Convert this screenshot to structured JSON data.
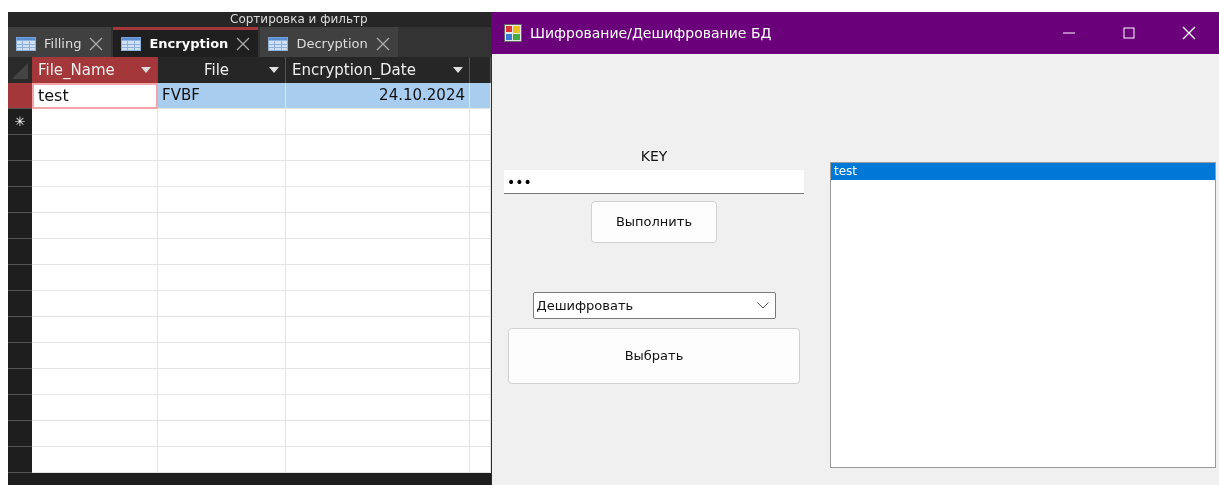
{
  "ribbon": {
    "group_label": "Сортировка и фильтр"
  },
  "tabs": [
    {
      "label": "Filling",
      "selected": false
    },
    {
      "label": "Encryption",
      "selected": true
    },
    {
      "label": "Decryption",
      "selected": false
    }
  ],
  "table": {
    "columns": [
      {
        "label": "File_Name",
        "selected": true
      },
      {
        "label": "File",
        "selected": false
      },
      {
        "label": "Encryption_Date",
        "selected": false
      }
    ],
    "rows": [
      {
        "cells": [
          "test",
          "FVBF",
          "24.10.2024"
        ],
        "selected": true
      }
    ],
    "new_row_marker": "✳"
  },
  "dialog": {
    "title": "Шифрование/Дешифрование БД",
    "key_label": "KEY",
    "key_field": {
      "value": "•••"
    },
    "run_button": "Выполнить",
    "mode_select": {
      "value": "Дешифровать"
    },
    "choose_button": "Выбрать",
    "list_items": [
      {
        "label": "test",
        "selected": true
      }
    ]
  }
}
